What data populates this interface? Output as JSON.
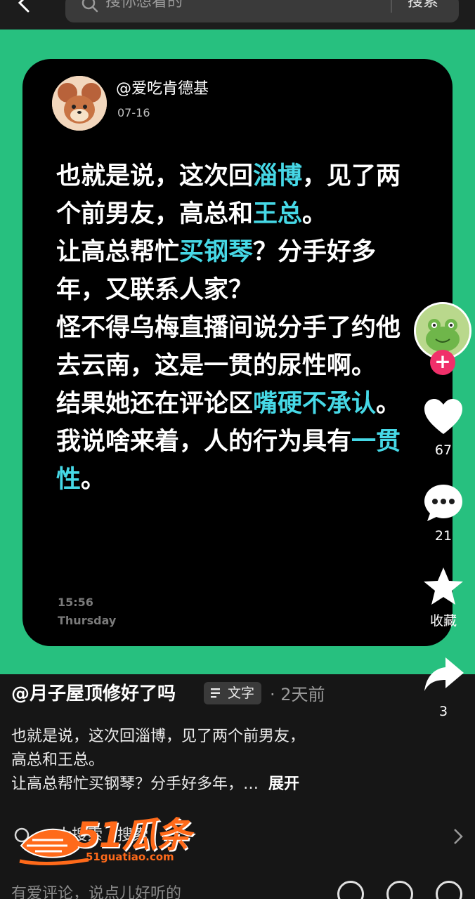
{
  "search": {
    "placeholder": "搜你想看的",
    "button": "搜索"
  },
  "card": {
    "user": "@爱吃肯德基",
    "date": "07-16",
    "paragraphs": [
      [
        {
          "t": "也就是说，这次回"
        },
        {
          "t": "淄博",
          "hl": true
        },
        {
          "t": "，见了两个前男友，高总和"
        },
        {
          "t": "王总",
          "hl": true
        },
        {
          "t": "。"
        }
      ],
      [
        {
          "t": "让高总帮忙"
        },
        {
          "t": "买钢琴",
          "hl": true
        },
        {
          "t": "？分手好多年，又联系人家？"
        }
      ],
      [
        {
          "t": "怪不得乌梅直播间说分手了约他去云南，这是一贯的尿性啊。"
        }
      ],
      [
        {
          "t": "结果她还在评论区"
        },
        {
          "t": "嘴硬不承认",
          "hl": true
        },
        {
          "t": "。"
        }
      ],
      [
        {
          "t": "我说啥来着，人的行为具有"
        },
        {
          "t": "一贯性",
          "hl": true
        },
        {
          "t": "。"
        }
      ]
    ],
    "time": "15:56",
    "day": "Thursday"
  },
  "actions": {
    "likes": "67",
    "comments": "21",
    "favorite": "收藏",
    "shares": "3"
  },
  "description": {
    "user": "@月子屋顶修好了吗",
    "tag": "文字",
    "time": "· 2天前",
    "line1": "也就是说，这次回淄博，见了两个前男友，",
    "line2": "高总和王总。",
    "line3": "让高总帮忙买钢琴？分手好多年，…",
    "expand": "展开"
  },
  "related": {
    "text": "大搜索 · 搜索"
  },
  "watermark": {
    "brand": "51瓜条",
    "url": "51guatiao.com"
  },
  "comment_bar": {
    "placeholder": "有爱评论，说点儿好听的"
  },
  "colors": {
    "green": "#27c07f",
    "highlight": "#46d8e6",
    "follow": "#f0306a",
    "brand": "#ff6a1a"
  }
}
